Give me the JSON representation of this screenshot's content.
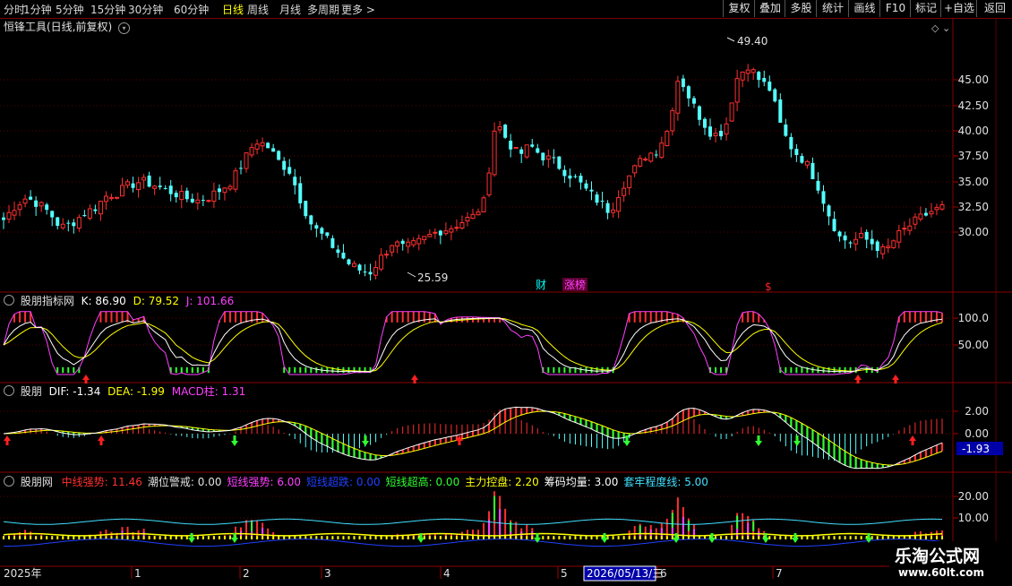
{
  "toolbar": {
    "periods": [
      "分时",
      "1分钟",
      "5分钟",
      "15分钟",
      "30分钟",
      "60分钟",
      "日线",
      "周线",
      "月线",
      "多周期",
      "更多 >"
    ],
    "active_period": "日线",
    "right_buttons": [
      "复权",
      "叠加",
      "多股",
      "统计",
      "画线",
      "F10",
      "标记",
      "+自选",
      "返回"
    ]
  },
  "main_panel": {
    "title": "恒锋工具(日线,前复权)",
    "high_label": "49.40",
    "low_label": "25.59",
    "markers": [
      {
        "text": "财",
        "color": "#00ffff"
      },
      {
        "text": "涨榜",
        "color": "#ff40ff"
      },
      {
        "text": "$",
        "color": "#ff2020"
      }
    ],
    "y_ticks": [
      "45.00",
      "42.50",
      "40.00",
      "37.50",
      "35.00",
      "32.50",
      "30.00"
    ]
  },
  "kdj_panel": {
    "name": "股朋指标网",
    "k": "K: 86.90",
    "d": "D: 79.52",
    "j": "J: 101.66",
    "y_ticks": [
      "100.0",
      "50.00"
    ]
  },
  "macd_panel": {
    "name": "股朋",
    "dif": "DIF: -1.34",
    "dea": "DEA: -1.99",
    "macd": "MACD柱: 1.31",
    "y_ticks": [
      "2.00",
      "0.00"
    ],
    "current_value": "-1.93"
  },
  "strength_panel": {
    "name": "股朋网",
    "items": [
      {
        "label": "中线强势: 11.46",
        "color": "#ff3030"
      },
      {
        "label": "潮位警戒: 0.00",
        "color": "#e0e0e0"
      },
      {
        "label": "短线强势: 6.00",
        "color": "#ff40ff"
      },
      {
        "label": "短线超跌: 0.00",
        "color": "#2040ff"
      },
      {
        "label": "短线超高: 0.00",
        "color": "#30ff30"
      },
      {
        "label": "主力控盘: 2.20",
        "color": "#ffff00"
      },
      {
        "label": "筹码均量: 3.00",
        "color": "#ffffff"
      },
      {
        "label": "套牢程度线: 5.00",
        "color": "#40e0ff"
      }
    ],
    "y_ticks": [
      "20.00",
      "10.00"
    ]
  },
  "x_axis": {
    "labels": [
      "2025年",
      "1",
      "2",
      "3",
      "4",
      "5",
      "6",
      "7"
    ],
    "cursor_date": "2026/05/13/三"
  },
  "watermark": {
    "line1": "乐淘公式网",
    "line2": "www.60lt.com"
  },
  "chart_data": {
    "type": "candlestick",
    "ylim": [
      24.5,
      51
    ],
    "close_samples": [
      31.2,
      32.6,
      33.4,
      32.8,
      31.9,
      30.4,
      30.9,
      31.8,
      32.4,
      33.6,
      33.9,
      34.6,
      35.0,
      34.7,
      34.2,
      33.8,
      33.3,
      33.1,
      33.5,
      34.2,
      35.1,
      37.0,
      39.0,
      38.5,
      37.0,
      36.0,
      33.0,
      30.5,
      29.5,
      28.3,
      27.0,
      26.3,
      26.0,
      27.5,
      29.0,
      28.4,
      28.8,
      29.5,
      30.1,
      30.4,
      31.0,
      31.5,
      33.0,
      41.0,
      39.0,
      37.5,
      38.5,
      37.5,
      37.0,
      36.0,
      35.2,
      34.0,
      33.0,
      32.0,
      34.5,
      36.0,
      37.5,
      38.0,
      40.0,
      45.5,
      43.0,
      41.0,
      39.5,
      40.0,
      45.0,
      46.5,
      45.0,
      44.0,
      40.0,
      38.0,
      37.0,
      35.0,
      32.0,
      29.5,
      29.0,
      29.5,
      28.8,
      28.0,
      29.5,
      30.5,
      31.3,
      32.0,
      32.4
    ]
  }
}
